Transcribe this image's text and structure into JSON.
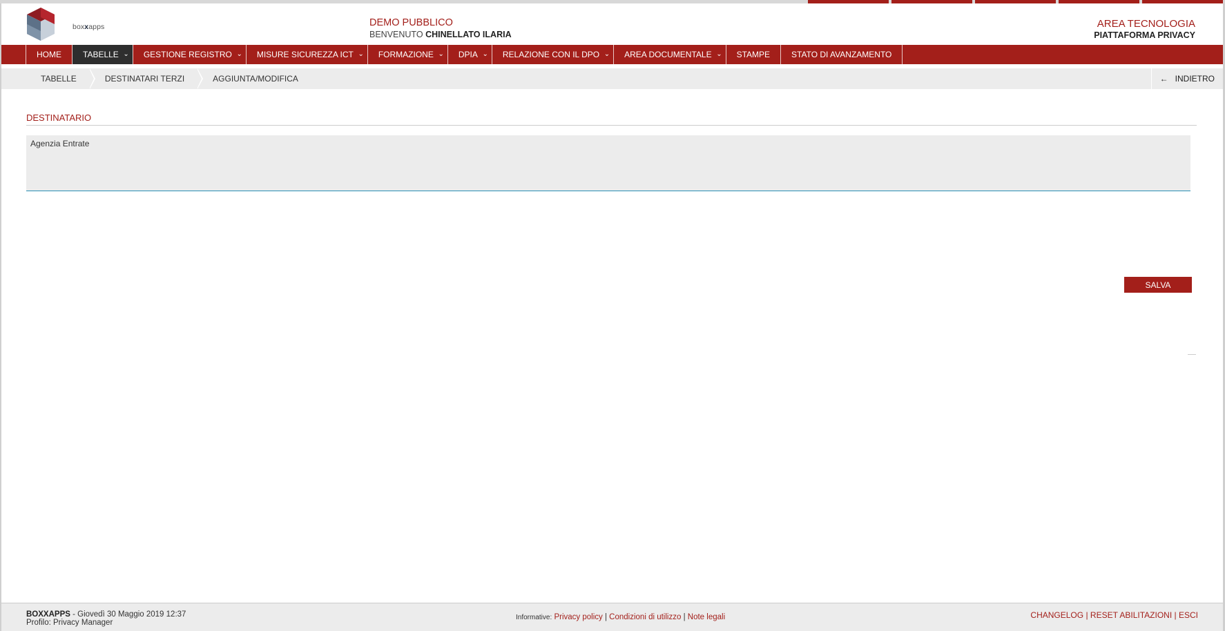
{
  "brand": {
    "logo_text_light": "box",
    "logo_text_bold": "x",
    "logo_text_tail": "apps",
    "colors": {
      "primary": "#a31f1a",
      "active_nav": "#2e2e2e",
      "panel": "#ececec",
      "focus": "#2a8fb5"
    }
  },
  "header": {
    "demo_title": "DEMO PUBBLICO",
    "welcome_prefix": "BENVENUTO",
    "welcome_user": "CHINELLATO ILARIA",
    "area_title": "AREA TECNOLOGIA",
    "platform_title": "PIATTAFORMA PRIVACY"
  },
  "nav": {
    "items": [
      {
        "label": "HOME",
        "dropdown": false
      },
      {
        "label": "TABELLE",
        "dropdown": true,
        "active": true
      },
      {
        "label": "GESTIONE REGISTRO",
        "dropdown": true
      },
      {
        "label": "MISURE SICUREZZA ICT",
        "dropdown": true
      },
      {
        "label": "FORMAZIONE",
        "dropdown": true
      },
      {
        "label": "DPIA",
        "dropdown": true
      },
      {
        "label": "RELAZIONE CON IL DPO",
        "dropdown": true
      },
      {
        "label": "AREA DOCUMENTALE",
        "dropdown": true
      },
      {
        "label": "STAMPE",
        "dropdown": false
      },
      {
        "label": "STATO DI AVANZAMENTO",
        "dropdown": false
      }
    ],
    "chevron": "chevron-down-icon"
  },
  "breadcrumb": {
    "items": [
      "TABELLE",
      "DESTINATARI TERZI",
      "AGGIUNTA/MODIFICA"
    ],
    "back_label": "INDIETRO",
    "back_icon": "arrow-left-icon"
  },
  "form": {
    "section_title": "DESTINATARIO",
    "destinatario_value": "Agenzia Entrate",
    "save_label": "SALVA"
  },
  "footer": {
    "app_name": "BOXXAPPS",
    "date_text": " - Giovedì 30 Maggio 2019 12:37",
    "profile_text": "Profilo: Privacy Manager",
    "info_prefix": "Informative:",
    "privacy_policy": "Privacy policy",
    "conditions": "Condizioni di utilizzo",
    "legal_notes": "Note legali",
    "separator": "|",
    "changelog": "CHANGELOG",
    "reset": "RESET ABILITAZIONI",
    "exit": "ESCI"
  }
}
